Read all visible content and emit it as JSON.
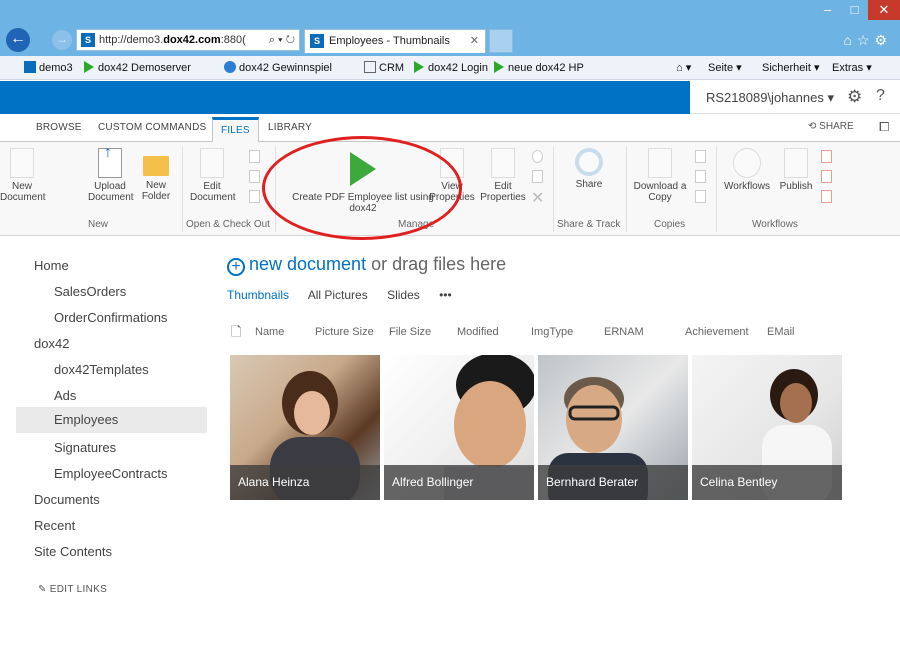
{
  "browser": {
    "url_prefix": "http://demo3.",
    "url_domain": "dox42.com",
    "url_suffix": ":880(",
    "tab_title": "Employees - Thumbnails",
    "favorites": [
      "demo3",
      "dox42 Demoserver",
      "dox42 Gewinnspiel",
      "CRM",
      "dox42 Login",
      "neue dox42 HP"
    ],
    "menu": [
      "Seite",
      "Sicherheit",
      "Extras"
    ]
  },
  "suitebar": {
    "user": "RS218089\\johannes"
  },
  "ribbon_tabs": [
    "BROWSE",
    "CUSTOM COMMANDS",
    "FILES",
    "LIBRARY"
  ],
  "share_label": "SHARE",
  "ribbon": {
    "new_document": "New Document",
    "upload_document": "Upload Document",
    "new_folder": "New Folder",
    "edit_document": "Edit Document",
    "create_pdf": "Create PDF Employee list using dox42",
    "view_properties": "View Properties",
    "edit_properties": "Edit Properties",
    "share": "Share",
    "download_copy": "Download a Copy",
    "workflows": "Workflows",
    "publish": "Publish",
    "groups": [
      "New",
      "Open & Check Out",
      "Manage",
      "Share & Track",
      "Copies",
      "Workflows"
    ]
  },
  "leftnav": {
    "items": [
      "Home",
      "SalesOrders",
      "OrderConfirmations",
      "dox42",
      "dox42Templates",
      "Ads",
      "Employees",
      "Signatures",
      "EmployeeContracts",
      "Documents",
      "Recent",
      "Site Contents"
    ],
    "edit_links": "EDIT LINKS"
  },
  "main": {
    "new_document": "new document",
    "drag_text": "or drag files here",
    "views": [
      "Thumbnails",
      "All Pictures",
      "Slides",
      "•••"
    ],
    "columns": [
      "Name",
      "Picture Size",
      "File Size",
      "Modified",
      "ImgType",
      "ERNAM",
      "Achievement",
      "EMail"
    ],
    "employees": [
      "Alana Heinza",
      "Alfred Bollinger",
      "Bernhard Berater",
      "Celina Bentley"
    ]
  }
}
